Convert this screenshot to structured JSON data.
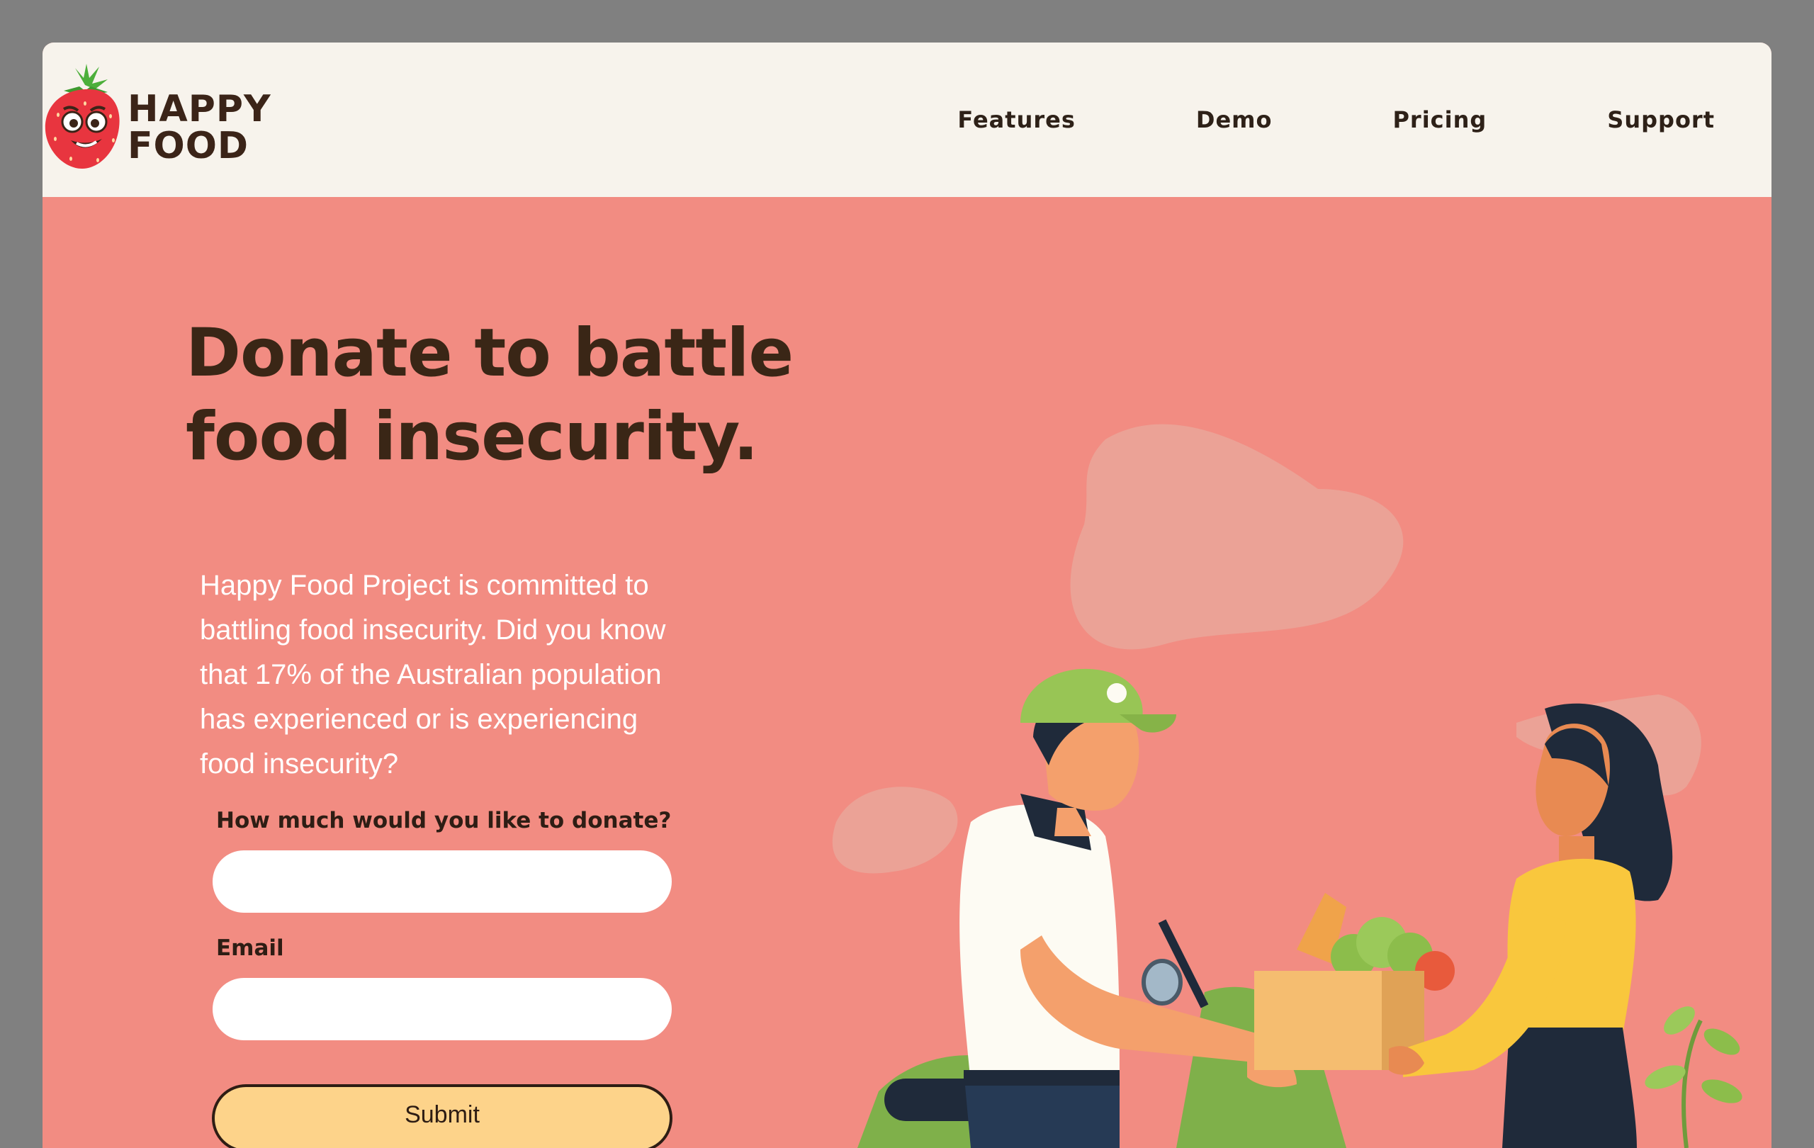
{
  "brand": {
    "name_line1": "HAPPY",
    "name_line2": "FOOD"
  },
  "nav": [
    {
      "label": "Features"
    },
    {
      "label": "Demo"
    },
    {
      "label": "Pricing"
    },
    {
      "label": "Support"
    }
  ],
  "hero": {
    "headline_line1": "Donate to battle",
    "headline_line2": "food insecurity.",
    "intro_lines": [
      "Happy Food Project is committed to",
      "battling food insecurity. Did you know",
      "that 17% of the Australian population",
      "has experienced or is experiencing",
      "food insecurity?"
    ]
  },
  "form": {
    "amount_label": "How much would you like to donate?",
    "amount_value": "",
    "email_label": "Email",
    "email_value": "",
    "submit_label": "Submit"
  },
  "colors": {
    "page_bg": "#f28c82",
    "header_bg": "#f7f3ec",
    "accent_button": "#fdd38a",
    "text_dark": "#3a2616"
  },
  "icons": {
    "logo": "strawberry-mascot-icon",
    "illustration": "food-delivery-illustration"
  }
}
